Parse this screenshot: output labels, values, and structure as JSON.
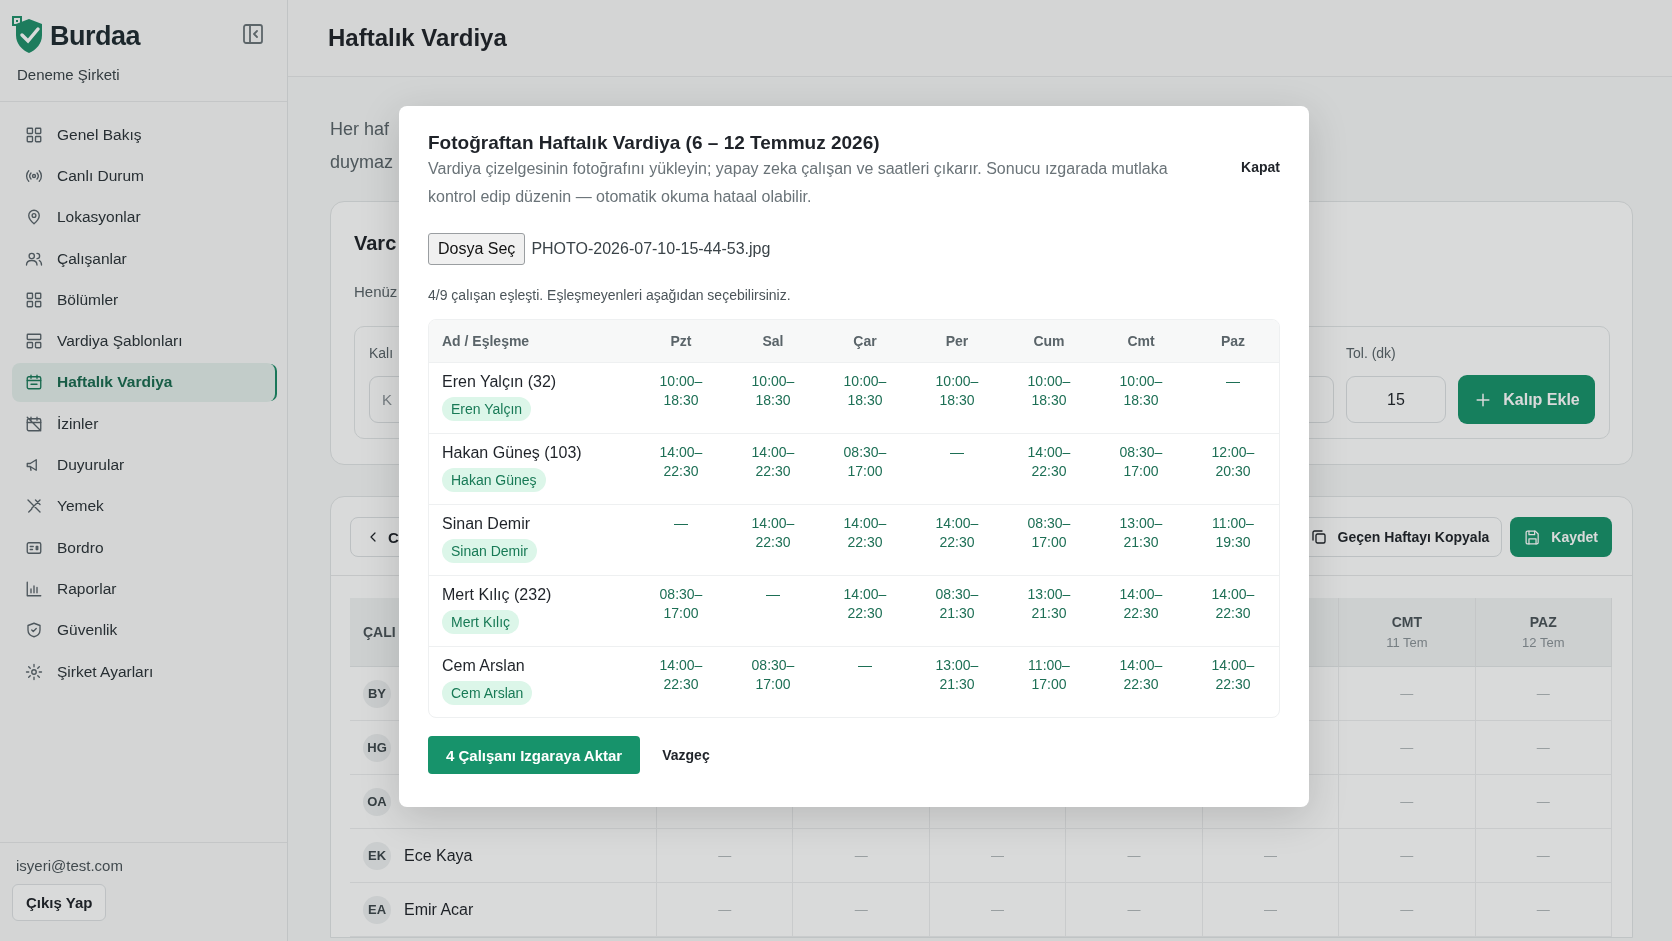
{
  "sidebar": {
    "brand": "Burdaa",
    "company": "Deneme Şirketi",
    "items": [
      {
        "label": "Genel Bakış",
        "selected": false
      },
      {
        "label": "Canlı Durum",
        "selected": false
      },
      {
        "label": "Lokasyonlar",
        "selected": false
      },
      {
        "label": "Çalışanlar",
        "selected": false
      },
      {
        "label": "Bölümler",
        "selected": false
      },
      {
        "label": "Vardiya Şablonları",
        "selected": false
      },
      {
        "label": "Haftalık Vardiya",
        "selected": true
      },
      {
        "label": "İzinler",
        "selected": false
      },
      {
        "label": "Duyurular",
        "selected": false
      },
      {
        "label": "Yemek",
        "selected": false
      },
      {
        "label": "Bordro",
        "selected": false
      },
      {
        "label": "Raporlar",
        "selected": false
      },
      {
        "label": "Güvenlik",
        "selected": false
      },
      {
        "label": "Şirket Ayarları",
        "selected": false
      }
    ],
    "user_email": "isyeri@test.com",
    "logout": "Çıkış Yap"
  },
  "header": {
    "title": "Haftalık Vardiya"
  },
  "intro": [
    "Her haf",
    "duymaz"
  ],
  "template_card": {
    "title": "Varc",
    "note": "Henüz",
    "name_label": "Kalı",
    "name_placeholder": "K",
    "tolerance_label": "Tol. (dk)",
    "tolerance_value": "15",
    "add_button": "Kalıp Ekle"
  },
  "schedule_card": {
    "prev_button": "C",
    "copy_button": "Geçen Haftayı Kopyala",
    "save_button": "Kaydet",
    "name_column": "ÇALI",
    "day_columns": [
      null,
      null,
      null,
      null,
      null,
      {
        "label": "CMT",
        "date": "11 Tem"
      },
      {
        "label": "PAZ",
        "date": "12 Tem"
      }
    ],
    "rows": [
      {
        "initials": "BY",
        "cells": [
          null,
          null,
          null,
          null,
          null,
          "—",
          "—"
        ]
      },
      {
        "initials": "HG",
        "cells": [
          null,
          null,
          null,
          null,
          null,
          "—",
          "—"
        ]
      },
      {
        "initials": "OA",
        "cells": [
          null,
          null,
          null,
          null,
          null,
          "—",
          "—"
        ]
      },
      {
        "initials": "EK",
        "name": "Ece Kaya",
        "cells": [
          "—",
          "—",
          "—",
          "—",
          "—",
          "—",
          "—"
        ]
      },
      {
        "initials": "EA",
        "name": "Emir Acar",
        "cells": [
          "—",
          "—",
          "—",
          "—",
          "—",
          "—",
          "—"
        ]
      }
    ]
  },
  "modal": {
    "title": "Fotoğraftan Haftalık Vardiya (6 – 12 Temmuz 2026)",
    "description": "Vardiya çizelgesinin fotoğrafını yükleyin; yapay zeka çalışan ve saatleri çıkarır. Sonucu ızgarada mutlaka kontrol edip düzenin — otomatik okuma hataal olabilir.",
    "close": "Kapat",
    "file_button": "Dosya Seç",
    "file_name": "PHOTO-2026-07-10-15-44-53.jpg",
    "match_info": "4/9 çalışan eşleşti. Eşleşmeyenleri aşağıdan seçebilirsiniz.",
    "columns": [
      "Ad / Eşleşme",
      "Pzt",
      "Sal",
      "Çar",
      "Per",
      "Cum",
      "Cmt",
      "Paz"
    ],
    "rows": [
      {
        "name": "Eren Yalçın (32)",
        "match": "Eren Yalçın",
        "shifts": [
          "10:00–18:30",
          "10:00–18:30",
          "10:00–18:30",
          "10:00–18:30",
          "10:00–18:30",
          "10:00–18:30",
          "—"
        ]
      },
      {
        "name": "Hakan Güneş (103)",
        "match": "Hakan Güneş",
        "shifts": [
          "14:00–22:30",
          "14:00–22:30",
          "08:30–17:00",
          "—",
          "14:00–22:30",
          "08:30–17:00",
          "12:00–20:30"
        ]
      },
      {
        "name": "Sinan Demir",
        "match": "Sinan Demir",
        "shifts": [
          "—",
          "14:00–22:30",
          "14:00–22:30",
          "14:00–22:30",
          "08:30–17:00",
          "13:00–21:30",
          "11:00–19:30"
        ]
      },
      {
        "name": "Mert Kılıç (232)",
        "match": "Mert Kılıç",
        "shifts": [
          "08:30–17:00",
          "—",
          "14:00–22:30",
          "08:30–21:30",
          "13:00–21:30",
          "14:00–22:30",
          "14:00–22:30"
        ]
      },
      {
        "name": "Cem Arslan",
        "match": "Cem Arslan",
        "shifts": [
          "14:00–22:30",
          "08:30–17:00",
          "—",
          "13:00–21:30",
          "11:00–17:00",
          "14:00–22:30",
          "14:00–22:30"
        ]
      }
    ],
    "import_button": "4 Çalışanı Izgaraya Aktar",
    "cancel": "Vazgeç"
  }
}
